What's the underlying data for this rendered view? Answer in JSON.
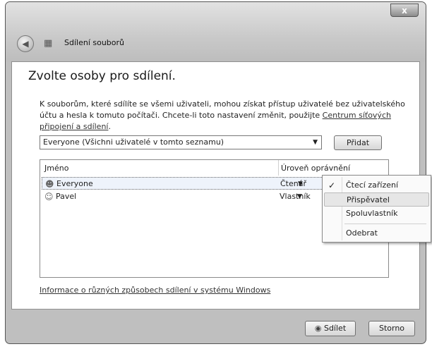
{
  "window": {
    "title": "Sdílení souborů",
    "close_label": "x"
  },
  "main": {
    "heading": "Zvolte osoby pro sdílení.",
    "description_text": "K souborům, které sdílíte se všemi uživateli, mohou získat přístup uživatelé bez uživatelského účtu a hesla k tomuto počítači. Chcete-li toto nastavení změnit, použijte ",
    "network_link": "Centrum síťových připojení a sdílení",
    "description_end": "."
  },
  "user_select": {
    "value": "Everyone (Všichni uživatelé v tomto seznamu)"
  },
  "add_button": {
    "label": "Přidat"
  },
  "list": {
    "columns": [
      "Jméno",
      "Úroveň oprávnění"
    ],
    "rows": [
      {
        "name": "Everyone",
        "permission": "Čtenář"
      },
      {
        "name": "Pavel",
        "permission": "Vlastník"
      }
    ]
  },
  "context_menu": {
    "items": [
      "Čtecí zařízení",
      "Přispěvatel",
      "Spoluvlastník",
      "Odebrat"
    ],
    "checked": "Čtecí zařízení",
    "hovered": "Přispěvatel"
  },
  "info_link": "Informace o různých způsobech sdílení v systému Windows",
  "footer": {
    "share_label": "Sdílet",
    "cancel_label": "Storno"
  }
}
